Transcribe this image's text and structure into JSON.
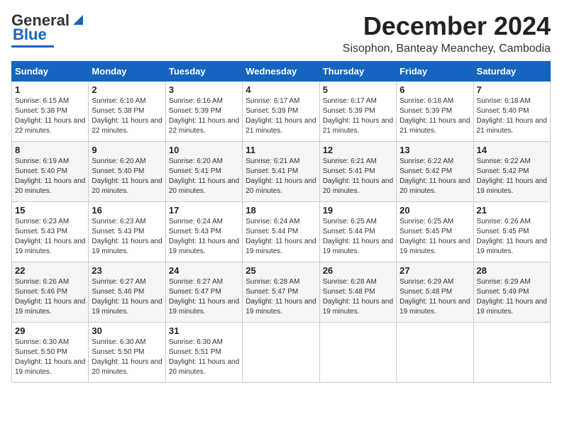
{
  "logo": {
    "general": "General",
    "blue": "Blue"
  },
  "title": {
    "month": "December 2024",
    "location": "Sisophon, Banteay Meanchey, Cambodia"
  },
  "headers": [
    "Sunday",
    "Monday",
    "Tuesday",
    "Wednesday",
    "Thursday",
    "Friday",
    "Saturday"
  ],
  "weeks": [
    [
      {
        "day": "1",
        "sunrise": "Sunrise: 6:15 AM",
        "sunset": "Sunset: 5:38 PM",
        "daylight": "Daylight: 11 hours and 22 minutes."
      },
      {
        "day": "2",
        "sunrise": "Sunrise: 6:16 AM",
        "sunset": "Sunset: 5:38 PM",
        "daylight": "Daylight: 11 hours and 22 minutes."
      },
      {
        "day": "3",
        "sunrise": "Sunrise: 6:16 AM",
        "sunset": "Sunset: 5:39 PM",
        "daylight": "Daylight: 11 hours and 22 minutes."
      },
      {
        "day": "4",
        "sunrise": "Sunrise: 6:17 AM",
        "sunset": "Sunset: 5:39 PM",
        "daylight": "Daylight: 11 hours and 21 minutes."
      },
      {
        "day": "5",
        "sunrise": "Sunrise: 6:17 AM",
        "sunset": "Sunset: 5:39 PM",
        "daylight": "Daylight: 11 hours and 21 minutes."
      },
      {
        "day": "6",
        "sunrise": "Sunrise: 6:18 AM",
        "sunset": "Sunset: 5:39 PM",
        "daylight": "Daylight: 11 hours and 21 minutes."
      },
      {
        "day": "7",
        "sunrise": "Sunrise: 6:18 AM",
        "sunset": "Sunset: 5:40 PM",
        "daylight": "Daylight: 11 hours and 21 minutes."
      }
    ],
    [
      {
        "day": "8",
        "sunrise": "Sunrise: 6:19 AM",
        "sunset": "Sunset: 5:40 PM",
        "daylight": "Daylight: 11 hours and 20 minutes."
      },
      {
        "day": "9",
        "sunrise": "Sunrise: 6:20 AM",
        "sunset": "Sunset: 5:40 PM",
        "daylight": "Daylight: 11 hours and 20 minutes."
      },
      {
        "day": "10",
        "sunrise": "Sunrise: 6:20 AM",
        "sunset": "Sunset: 5:41 PM",
        "daylight": "Daylight: 11 hours and 20 minutes."
      },
      {
        "day": "11",
        "sunrise": "Sunrise: 6:21 AM",
        "sunset": "Sunset: 5:41 PM",
        "daylight": "Daylight: 11 hours and 20 minutes."
      },
      {
        "day": "12",
        "sunrise": "Sunrise: 6:21 AM",
        "sunset": "Sunset: 5:41 PM",
        "daylight": "Daylight: 11 hours and 20 minutes."
      },
      {
        "day": "13",
        "sunrise": "Sunrise: 6:22 AM",
        "sunset": "Sunset: 5:42 PM",
        "daylight": "Daylight: 11 hours and 20 minutes."
      },
      {
        "day": "14",
        "sunrise": "Sunrise: 6:22 AM",
        "sunset": "Sunset: 5:42 PM",
        "daylight": "Daylight: 11 hours and 19 minutes."
      }
    ],
    [
      {
        "day": "15",
        "sunrise": "Sunrise: 6:23 AM",
        "sunset": "Sunset: 5:43 PM",
        "daylight": "Daylight: 11 hours and 19 minutes."
      },
      {
        "day": "16",
        "sunrise": "Sunrise: 6:23 AM",
        "sunset": "Sunset: 5:43 PM",
        "daylight": "Daylight: 11 hours and 19 minutes."
      },
      {
        "day": "17",
        "sunrise": "Sunrise: 6:24 AM",
        "sunset": "Sunset: 5:43 PM",
        "daylight": "Daylight: 11 hours and 19 minutes."
      },
      {
        "day": "18",
        "sunrise": "Sunrise: 6:24 AM",
        "sunset": "Sunset: 5:44 PM",
        "daylight": "Daylight: 11 hours and 19 minutes."
      },
      {
        "day": "19",
        "sunrise": "Sunrise: 6:25 AM",
        "sunset": "Sunset: 5:44 PM",
        "daylight": "Daylight: 11 hours and 19 minutes."
      },
      {
        "day": "20",
        "sunrise": "Sunrise: 6:25 AM",
        "sunset": "Sunset: 5:45 PM",
        "daylight": "Daylight: 11 hours and 19 minutes."
      },
      {
        "day": "21",
        "sunrise": "Sunrise: 6:26 AM",
        "sunset": "Sunset: 5:45 PM",
        "daylight": "Daylight: 11 hours and 19 minutes."
      }
    ],
    [
      {
        "day": "22",
        "sunrise": "Sunrise: 6:26 AM",
        "sunset": "Sunset: 5:46 PM",
        "daylight": "Daylight: 11 hours and 19 minutes."
      },
      {
        "day": "23",
        "sunrise": "Sunrise: 6:27 AM",
        "sunset": "Sunset: 5:46 PM",
        "daylight": "Daylight: 11 hours and 19 minutes."
      },
      {
        "day": "24",
        "sunrise": "Sunrise: 6:27 AM",
        "sunset": "Sunset: 5:47 PM",
        "daylight": "Daylight: 11 hours and 19 minutes."
      },
      {
        "day": "25",
        "sunrise": "Sunrise: 6:28 AM",
        "sunset": "Sunset: 5:47 PM",
        "daylight": "Daylight: 11 hours and 19 minutes."
      },
      {
        "day": "26",
        "sunrise": "Sunrise: 6:28 AM",
        "sunset": "Sunset: 5:48 PM",
        "daylight": "Daylight: 11 hours and 19 minutes."
      },
      {
        "day": "27",
        "sunrise": "Sunrise: 6:29 AM",
        "sunset": "Sunset: 5:48 PM",
        "daylight": "Daylight: 11 hours and 19 minutes."
      },
      {
        "day": "28",
        "sunrise": "Sunrise: 6:29 AM",
        "sunset": "Sunset: 5:49 PM",
        "daylight": "Daylight: 11 hours and 19 minutes."
      }
    ],
    [
      {
        "day": "29",
        "sunrise": "Sunrise: 6:30 AM",
        "sunset": "Sunset: 5:50 PM",
        "daylight": "Daylight: 11 hours and 19 minutes."
      },
      {
        "day": "30",
        "sunrise": "Sunrise: 6:30 AM",
        "sunset": "Sunset: 5:50 PM",
        "daylight": "Daylight: 11 hours and 20 minutes."
      },
      {
        "day": "31",
        "sunrise": "Sunrise: 6:30 AM",
        "sunset": "Sunset: 5:51 PM",
        "daylight": "Daylight: 11 hours and 20 minutes."
      },
      null,
      null,
      null,
      null
    ]
  ]
}
